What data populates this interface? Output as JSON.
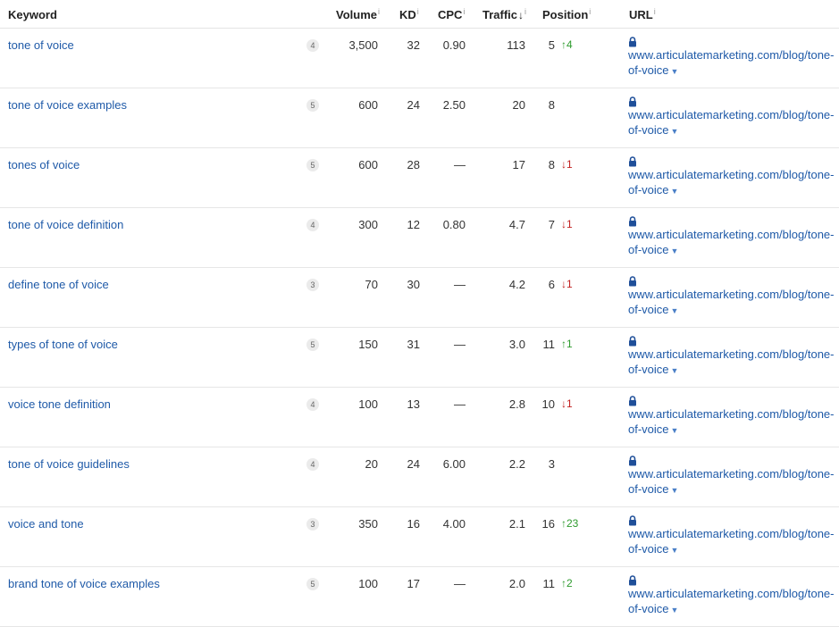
{
  "headers": {
    "keyword": "Keyword",
    "volume": "Volume",
    "kd": "KD",
    "cpc": "CPC",
    "traffic": "Traffic",
    "traffic_sort": "↓",
    "position": "Position",
    "url": "URL",
    "info": "i"
  },
  "rows": [
    {
      "keyword": "tone of voice",
      "serp": "4",
      "volume": "3,500",
      "kd": "32",
      "cpc": "0.90",
      "traffic": "113",
      "position": "5",
      "change": "↑4",
      "dir": "up",
      "url": "www.articulatemarketing.com/blog/tone-of-voice"
    },
    {
      "keyword": "tone of voice examples",
      "serp": "5",
      "volume": "600",
      "kd": "24",
      "cpc": "2.50",
      "traffic": "20",
      "position": "8",
      "change": "",
      "dir": "",
      "url": "www.articulatemarketing.com/blog/tone-of-voice"
    },
    {
      "keyword": "tones of voice",
      "serp": "5",
      "volume": "600",
      "kd": "28",
      "cpc": "—",
      "traffic": "17",
      "position": "8",
      "change": "↓1",
      "dir": "down",
      "url": "www.articulatemarketing.com/blog/tone-of-voice"
    },
    {
      "keyword": "tone of voice definition",
      "serp": "4",
      "volume": "300",
      "kd": "12",
      "cpc": "0.80",
      "traffic": "4.7",
      "position": "7",
      "change": "↓1",
      "dir": "down",
      "url": "www.articulatemarketing.com/blog/tone-of-voice"
    },
    {
      "keyword": "define tone of voice",
      "serp": "3",
      "volume": "70",
      "kd": "30",
      "cpc": "—",
      "traffic": "4.2",
      "position": "6",
      "change": "↓1",
      "dir": "down",
      "url": "www.articulatemarketing.com/blog/tone-of-voice"
    },
    {
      "keyword": "types of tone of voice",
      "serp": "5",
      "volume": "150",
      "kd": "31",
      "cpc": "—",
      "traffic": "3.0",
      "position": "11",
      "change": "↑1",
      "dir": "up",
      "url": "www.articulatemarketing.com/blog/tone-of-voice"
    },
    {
      "keyword": "voice tone definition",
      "serp": "4",
      "volume": "100",
      "kd": "13",
      "cpc": "—",
      "traffic": "2.8",
      "position": "10",
      "change": "↓1",
      "dir": "down",
      "url": "www.articulatemarketing.com/blog/tone-of-voice"
    },
    {
      "keyword": "tone of voice guidelines",
      "serp": "4",
      "volume": "20",
      "kd": "24",
      "cpc": "6.00",
      "traffic": "2.2",
      "position": "3",
      "change": "",
      "dir": "",
      "url": "www.articulatemarketing.com/blog/tone-of-voice"
    },
    {
      "keyword": "voice and tone",
      "serp": "3",
      "volume": "350",
      "kd": "16",
      "cpc": "4.00",
      "traffic": "2.1",
      "position": "16",
      "change": "↑23",
      "dir": "up",
      "url": "www.articulatemarketing.com/blog/tone-of-voice"
    },
    {
      "keyword": "brand tone of voice examples",
      "serp": "5",
      "volume": "100",
      "kd": "17",
      "cpc": "—",
      "traffic": "2.0",
      "position": "11",
      "change": "↑2",
      "dir": "up",
      "url": "www.articulatemarketing.com/blog/tone-of-voice"
    }
  ],
  "colors": {
    "link": "#1f5aa8",
    "up": "#2e9b2e",
    "down": "#c22121"
  }
}
